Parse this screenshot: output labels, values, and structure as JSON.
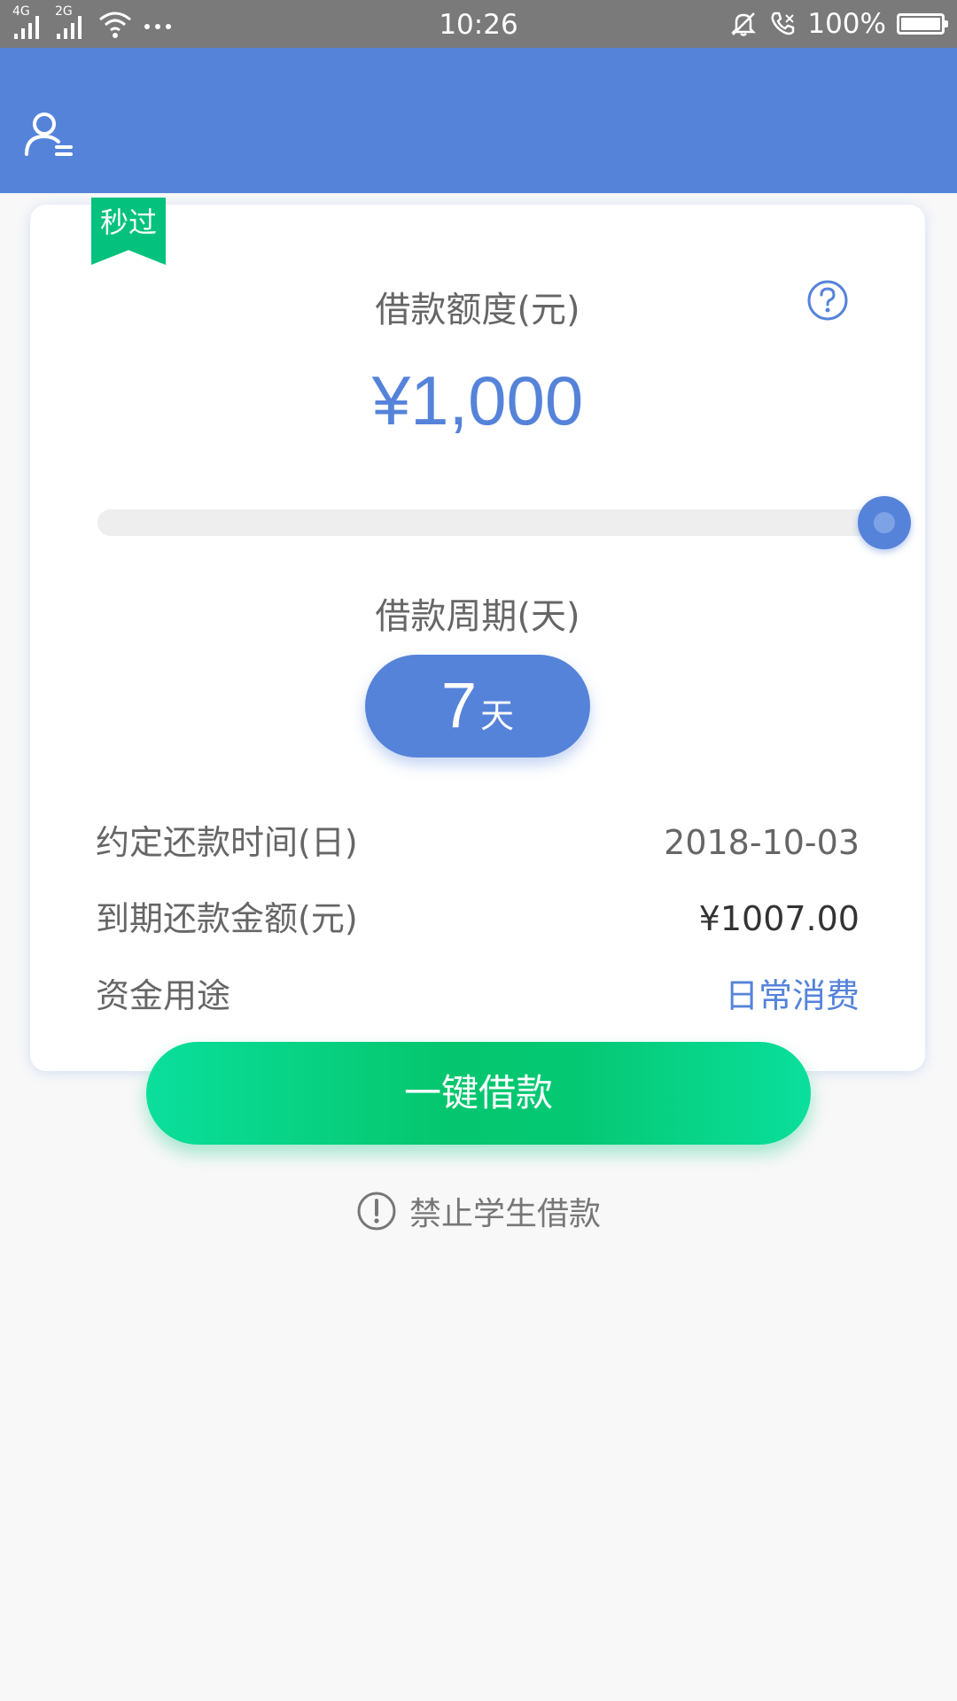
{
  "status_bar": {
    "network_1": "4G",
    "network_2": "2G",
    "time": "10:26",
    "battery": "100%",
    "battery_level": 100,
    "icons": [
      "signal-icon",
      "signal-icon",
      "wifi-icon",
      "more-dots-icon",
      "mute-bell-icon",
      "call-icon",
      "battery-icon"
    ]
  },
  "header": {
    "profile_icon": "user-profile-icon"
  },
  "card": {
    "badge": "秒过",
    "help_icon": "question-icon",
    "amount_label": "借款额度(元)",
    "amount_value": "¥1,000",
    "slider_fraction": 1.0,
    "period_label": "借款周期(天)",
    "period_value": "7",
    "period_unit": "天",
    "rows": [
      {
        "label": "约定还款时间(日)",
        "value": "2018-10-03"
      },
      {
        "label": "到期还款金额(元)",
        "value": "¥1007.00"
      },
      {
        "label": "资金用途",
        "value": "日常消费"
      }
    ]
  },
  "cta": {
    "label": "一键借款"
  },
  "notice": {
    "icon": "exclamation-circle-icon",
    "text": "禁止学生借款"
  },
  "colors": {
    "primary": "#5683da",
    "accent_green": "#04c27d",
    "status_bar": "#7a7a7a",
    "background": "#f8f8f8"
  }
}
